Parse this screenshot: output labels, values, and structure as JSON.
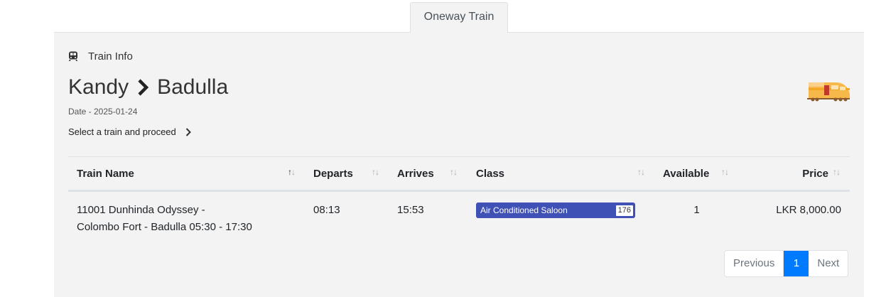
{
  "tab": {
    "label": "Oneway Train"
  },
  "info": {
    "label": "Train Info"
  },
  "route": {
    "from": "Kandy",
    "to": "Badulla"
  },
  "date_text": "Date - 2025-01-24",
  "proceed_text": "Select a train and proceed",
  "table": {
    "headers": {
      "train_name": "Train Name",
      "departs": "Departs",
      "arrives": "Arrives",
      "class": "Class",
      "available": "Available",
      "price": "Price"
    },
    "rows": [
      {
        "train_name_line1": "11001 Dunhinda Odyssey -",
        "train_name_line2": "Colombo Fort - Badulla 05:30 - 17:30",
        "departs": "08:13",
        "arrives": "15:53",
        "class_name": "Air Conditioned Saloon",
        "class_count": "176",
        "available": "1",
        "price": "LKR 8,000.00"
      }
    ]
  },
  "pagination": {
    "previous": "Previous",
    "current": "1",
    "next": "Next"
  },
  "colors": {
    "badge": "#3f51b5",
    "active_page": "#007bff",
    "panel_bg": "#f3f3f3"
  },
  "icons": {
    "info": "train-icon",
    "route_separator": "chevron-right-icon",
    "illustration": "train-illustration"
  }
}
